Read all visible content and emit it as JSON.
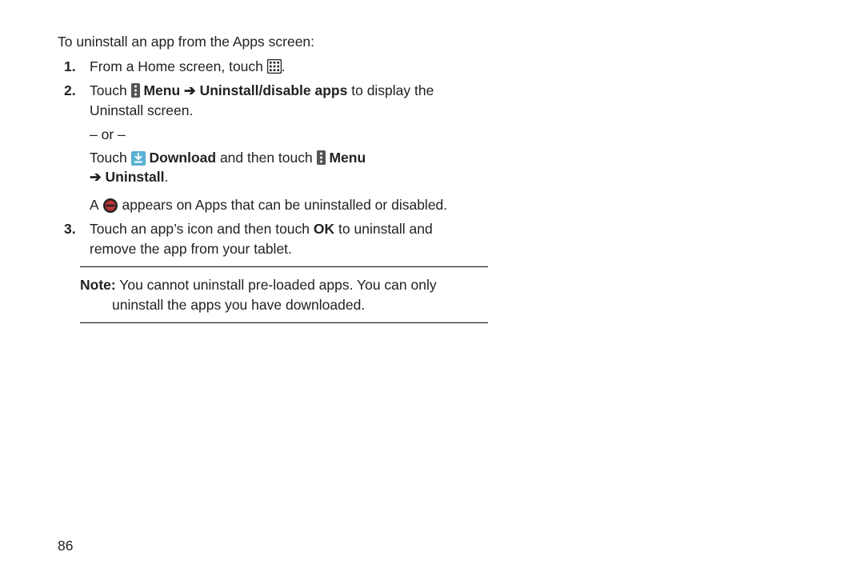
{
  "intro": "To uninstall an app from the Apps screen:",
  "steps": {
    "s1_a": "From a Home screen, touch",
    "s1_period": ".",
    "s2_a": "Touch",
    "s2_menu": "Menu",
    "s2_arrow": "➔",
    "s2_path": "Uninstall/disable apps",
    "s2_b": "to display the Uninstall screen.",
    "or_line": "– or –",
    "s2_c": "Touch",
    "s2_download": "Download",
    "s2_d": "and then touch",
    "s2_menu2": "Menu",
    "s2_arrow2": "➔",
    "s2_uninstall": "Uninstall",
    "s2_period": ".",
    "s2_e_a": "A",
    "s2_e_b": "appears on Apps that can be uninstalled or disabled.",
    "s3_a": "Touch an app’s icon and then touch",
    "s3_ok": "OK",
    "s3_b": "to uninstall and remove the app from your tablet."
  },
  "note": {
    "label": "Note:",
    "text": "You cannot uninstall pre-loaded apps. You can only uninstall the apps you have downloaded."
  },
  "page_number": "86"
}
